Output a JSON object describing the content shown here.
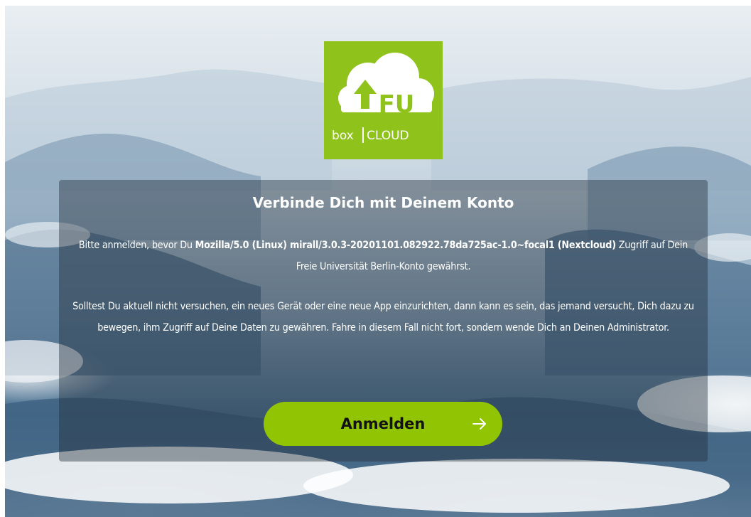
{
  "logo": {
    "fu_text": "FU",
    "brand_left": "box",
    "brand_right": "CLOUD",
    "bg_color": "#8fc21a"
  },
  "login": {
    "title": "Verbinde Dich mit Deinem Konto",
    "para1_prefix": "Bitte anmelden, bevor Du ",
    "client_name": "Mozilla/5.0 (Linux) mirall/3.0.3-20201101.082922.78da725ac-1.0~focal1 (Nextcloud)",
    "para1_suffix": " Zugriff auf Dein Freie Universität Berlin-Konto gewährst.",
    "para2": "Solltest Du aktuell nicht versuchen, ein neues Gerät oder eine neue App einzurichten, dann kann es sein, das jemand versucht, Dich dazu zu bewegen, ihm Zugriff auf Deine Daten zu gewähren. Fahre in diesem Fall nicht fort, sondern wende Dich an Deinen Administrator.",
    "button_label": "Anmelden",
    "button_icon": "arrow-right-icon",
    "button_color": "#91c402"
  }
}
